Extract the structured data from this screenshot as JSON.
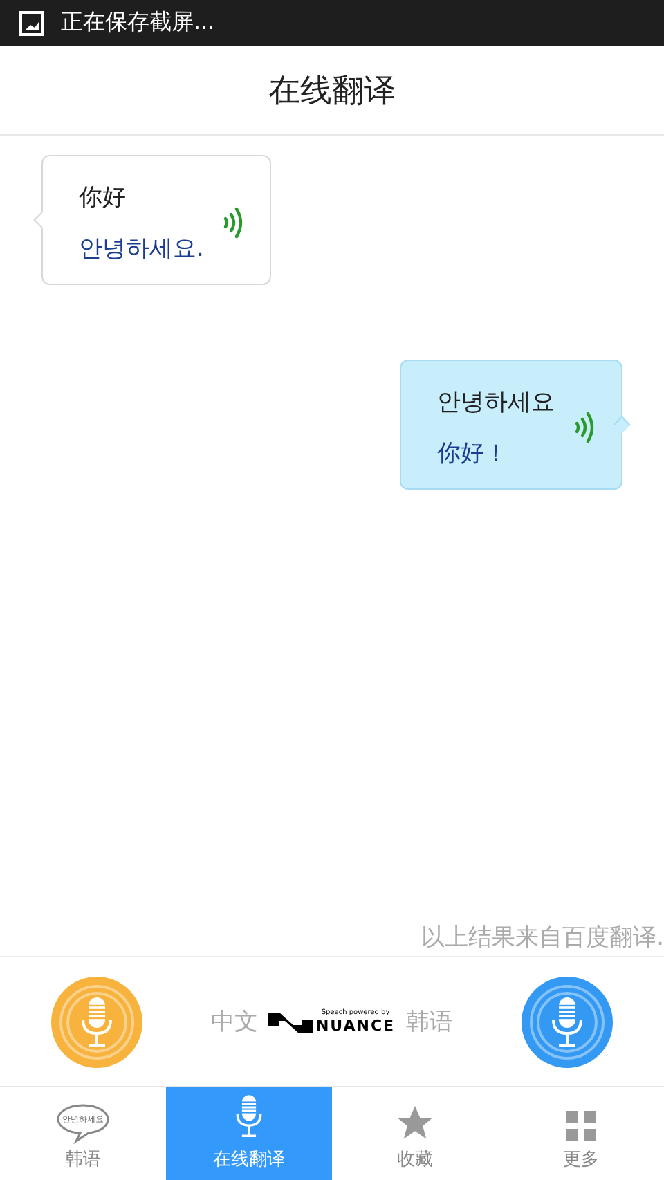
{
  "status_bar": {
    "notification": "正在保存截屏..."
  },
  "header": {
    "title": "在线翻译"
  },
  "messages": [
    {
      "kind": "received",
      "source": "你好",
      "translation": "안녕하세요."
    },
    {
      "kind": "sent",
      "source": "안녕하세요",
      "translation": "你好！"
    }
  ],
  "notice": "以上结果来自百度翻译.",
  "controls": {
    "left_language": "中文",
    "right_language": "韩语",
    "logo_caption": "Speech powered by",
    "logo_name": "NUANCE"
  },
  "tabs": [
    {
      "kind": "bubble",
      "icon_text": "안녕하세요",
      "label": "韩语",
      "selected": false
    },
    {
      "kind": "mic",
      "label": "在线翻译",
      "selected": true
    },
    {
      "kind": "star",
      "label": "收藏",
      "selected": false
    },
    {
      "kind": "grid",
      "label": "更多",
      "selected": false
    }
  ]
}
